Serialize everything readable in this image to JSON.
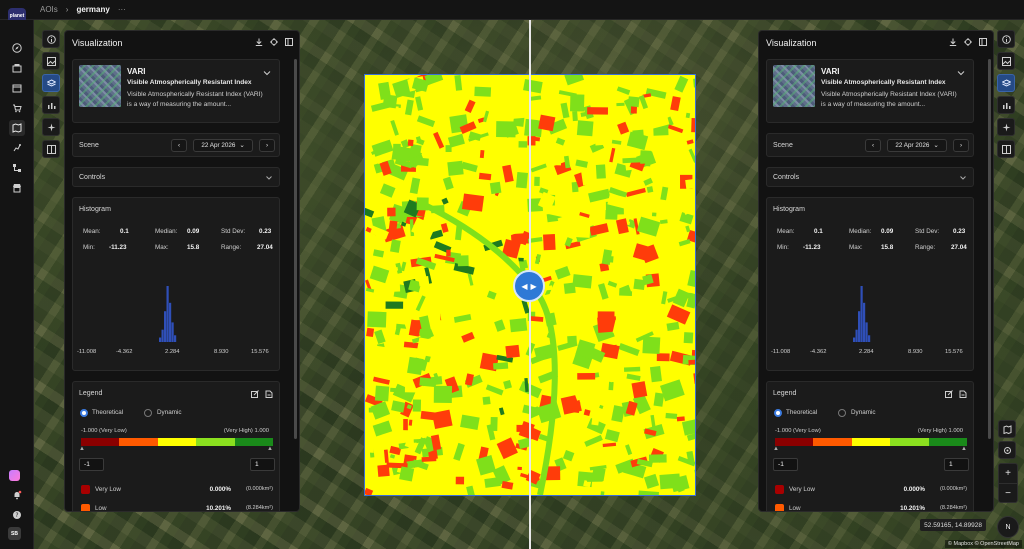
{
  "app": {
    "logo_text": "planet"
  },
  "breadcrumb": {
    "root": "AOIs",
    "current": "germany",
    "more": "···"
  },
  "user": {
    "initials": "SB"
  },
  "left_panel": {
    "title": "Visualization",
    "index": {
      "short_name": "VARI",
      "full_name": "Visible Atmospherically Resistant Index",
      "description": "Visible Atmospherically Resistant Index (VARI) is a way of measuring the amount..."
    },
    "scene": {
      "label": "Scene",
      "date": "22 Apr 2026"
    },
    "controls": {
      "label": "Controls"
    },
    "histogram": {
      "label": "Histogram",
      "stats": {
        "mean_label": "Mean:",
        "mean": "0.1",
        "median_label": "Median:",
        "median": "0.09",
        "std_label": "Std Dev:",
        "std": "0.23",
        "min_label": "Min:",
        "min": "-11.23",
        "max_label": "Max:",
        "max": "15.8",
        "range_label": "Range:",
        "range": "27.04"
      },
      "ticks": [
        "-11.008",
        "-4.362",
        "2.284",
        "8.930",
        "15.576"
      ],
      "bars": [
        0.08,
        0.22,
        0.55,
        1.0,
        0.7,
        0.35,
        0.12
      ]
    },
    "legend": {
      "label": "Legend",
      "mode_theoretical": "Theoretical",
      "mode_dynamic": "Dynamic",
      "selected_mode": "Theoretical",
      "low_label": "-1.000 (Very Low)",
      "high_label": "(Very High) 1.000",
      "min_input": "-1",
      "max_input": "1",
      "ramp_colors": [
        "#8b0000",
        "#ff5a00",
        "#ffff00",
        "#8be01f",
        "#1a8a1a"
      ],
      "classes": [
        {
          "name": "Very Low",
          "color": "#a80000",
          "percent": "0.000%",
          "area": "(0.000km²)"
        },
        {
          "name": "Low",
          "color": "#ff5a00",
          "percent": "10.201%",
          "area": "(8.284km²)"
        }
      ]
    }
  },
  "map": {
    "coordinates": "52.59165, 14.89928",
    "attribution": "© Mapbox © OpenStreetMap",
    "compass": "N",
    "overlay_colors": {
      "yellow": "#ffff00",
      "green": "#7fe01a",
      "dark_green": "#1f7a1f",
      "red": "#ff3c0a"
    }
  }
}
